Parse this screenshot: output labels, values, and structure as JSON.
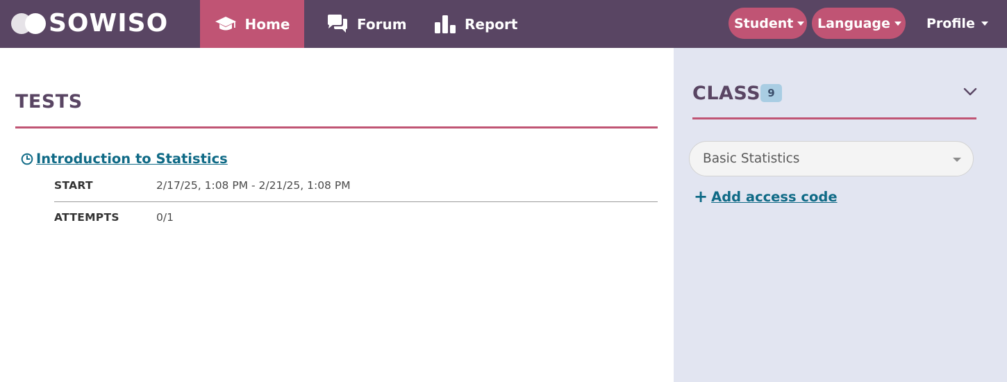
{
  "brand": {
    "name": "SOWISO"
  },
  "nav": {
    "home": "Home",
    "forum": "Forum",
    "report": "Report",
    "student": "Student",
    "language": "Language",
    "profile": "Profile"
  },
  "tests": {
    "title": "TESTS",
    "items": [
      {
        "name": "Introduction to Statistics",
        "start_label": "START",
        "start_value": "2/17/25, 1:08 PM - 2/21/25, 1:08 PM",
        "attempts_label": "ATTEMPTS",
        "attempts_value": "0/1"
      }
    ]
  },
  "class_panel": {
    "title": "CLASS",
    "count": "9",
    "selected": "Basic Statistics",
    "add_code": "Add access code"
  },
  "colors": {
    "navbar": "#594563",
    "accent": "#c05474",
    "link": "#0f6a86",
    "sidebar_bg": "#e2e5f1",
    "badge": "#a9cde3"
  },
  "icons": [
    "graduation-cap-icon",
    "chat-bubbles-icon",
    "bar-chart-icon",
    "clock-icon",
    "chevron-down-icon",
    "plus-icon"
  ]
}
